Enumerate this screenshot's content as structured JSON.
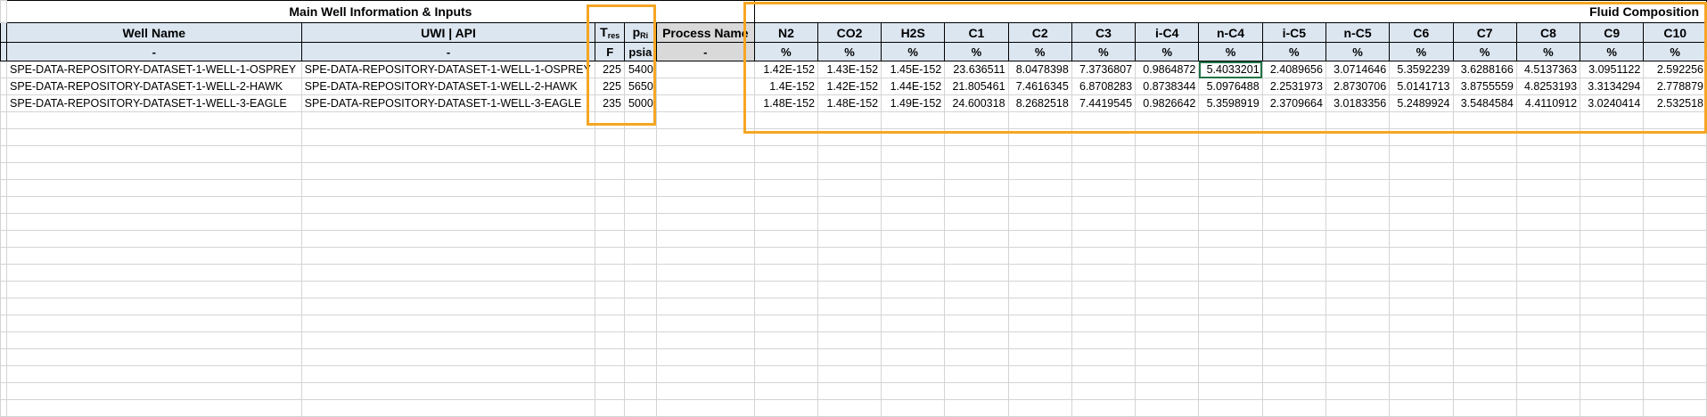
{
  "groups": {
    "main": "Main Well Information & Inputs",
    "fluid": "Fluid Composition"
  },
  "headers": {
    "well_name": "Well Name",
    "uwi": "UWI | API",
    "tres_main": "T",
    "tres_sub": "res",
    "pri_main": "p",
    "pri_sub": "Ri",
    "process": "Process Name",
    "components": [
      "N2",
      "CO2",
      "H2S",
      "C1",
      "C2",
      "C3",
      "i-C4",
      "n-C4",
      "i-C5",
      "n-C5",
      "C6",
      "C7",
      "C8",
      "C9",
      "C10"
    ]
  },
  "units": {
    "well_name": "-",
    "uwi": "-",
    "tres": "F",
    "pri": "psia",
    "process": "-",
    "components": [
      "%",
      "%",
      "%",
      "%",
      "%",
      "%",
      "%",
      "%",
      "%",
      "%",
      "%",
      "%",
      "%",
      "%",
      "%"
    ]
  },
  "rows": [
    {
      "well_name": "SPE-DATA-REPOSITORY-DATASET-1-WELL-1-OSPREY",
      "uwi": "SPE-DATA-REPOSITORY-DATASET-1-WELL-1-OSPREY",
      "tres": "225",
      "pri": "5400",
      "process": "",
      "comp": [
        "1.42E-152",
        "1.43E-152",
        "1.45E-152",
        "23.636511",
        "8.0478398",
        "7.3736807",
        "0.9864872",
        "5.4033201",
        "2.4089656",
        "3.0714646",
        "5.3592239",
        "3.6288166",
        "4.5137363",
        "3.0951122",
        "2.592256"
      ]
    },
    {
      "well_name": "SPE-DATA-REPOSITORY-DATASET-1-WELL-2-HAWK",
      "uwi": "SPE-DATA-REPOSITORY-DATASET-1-WELL-2-HAWK",
      "tres": "225",
      "pri": "5650",
      "process": "",
      "comp": [
        "1.4E-152",
        "1.42E-152",
        "1.44E-152",
        "21.805461",
        "7.4616345",
        "6.8708283",
        "0.8738344",
        "5.0976488",
        "2.2531973",
        "2.8730706",
        "5.0141713",
        "3.8755559",
        "4.8253193",
        "3.3134294",
        "2.778879"
      ]
    },
    {
      "well_name": "SPE-DATA-REPOSITORY-DATASET-1-WELL-3-EAGLE",
      "uwi": "SPE-DATA-REPOSITORY-DATASET-1-WELL-3-EAGLE",
      "tres": "235",
      "pri": "5000",
      "process": "",
      "comp": [
        "1.48E-152",
        "1.48E-152",
        "1.49E-152",
        "24.600318",
        "8.2682518",
        "7.4419545",
        "0.9826642",
        "5.3598919",
        "2.3709664",
        "3.0183356",
        "5.2489924",
        "3.5484584",
        "4.4110912",
        "3.0240414",
        "2.532518"
      ]
    }
  ],
  "colors": {
    "header_fill": "#dce6f1",
    "process_fill": "#d9d9d9",
    "highlight": "#f5a623",
    "selection": "#217346"
  }
}
